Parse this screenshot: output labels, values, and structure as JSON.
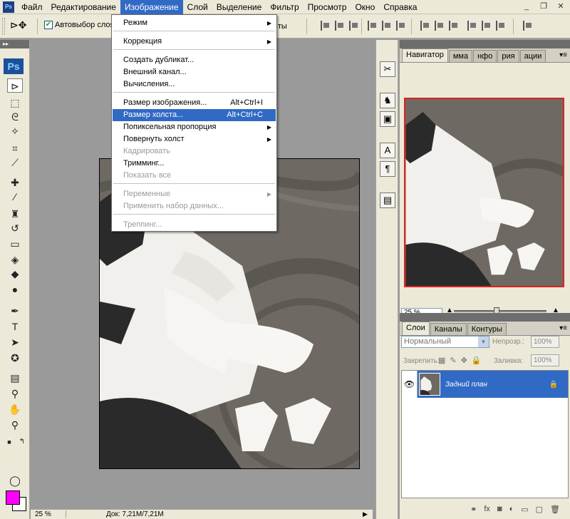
{
  "menubar": {
    "app_icon": "Ps",
    "items": [
      "Файл",
      "Редактирование",
      "Изображение",
      "Слой",
      "Выделение",
      "Фильтр",
      "Просмотр",
      "Окно",
      "Справка"
    ]
  },
  "options": {
    "autoselect_label": "Автовыбор слоя",
    "transform_label": "ементы"
  },
  "toolbox": {
    "logo": "Ps",
    "fg_color": "#ff00ff",
    "bg_color": "#ffffff"
  },
  "image_menu": {
    "items": [
      {
        "label": "Режим",
        "shortcut": "",
        "submenu": true,
        "disabled": false
      },
      {
        "label": "Коррекция",
        "shortcut": "",
        "submenu": true,
        "disabled": false
      },
      {
        "label": "Создать дубликат...",
        "shortcut": "",
        "submenu": false,
        "disabled": false
      },
      {
        "label": "Внешний канал...",
        "shortcut": "",
        "submenu": false,
        "disabled": false
      },
      {
        "label": "Вычисления...",
        "shortcut": "",
        "submenu": false,
        "disabled": false
      },
      {
        "label": "Размер изображения...",
        "shortcut": "Alt+Ctrl+I",
        "submenu": false,
        "disabled": false
      },
      {
        "label": "Размер холста...",
        "shortcut": "Alt+Ctrl+C",
        "submenu": false,
        "disabled": false,
        "highlighted": true
      },
      {
        "label": "Попиксельная пропорция",
        "shortcut": "",
        "submenu": true,
        "disabled": false
      },
      {
        "label": "Повернуть холст",
        "shortcut": "",
        "submenu": true,
        "disabled": false
      },
      {
        "label": "Кадрировать",
        "shortcut": "",
        "submenu": false,
        "disabled": true
      },
      {
        "label": "Тримминг...",
        "shortcut": "",
        "submenu": false,
        "disabled": false
      },
      {
        "label": "Показать все",
        "shortcut": "",
        "submenu": false,
        "disabled": true
      },
      {
        "label": "Переменные",
        "shortcut": "",
        "submenu": true,
        "disabled": true
      },
      {
        "label": "Применить набор данных...",
        "shortcut": "",
        "submenu": false,
        "disabled": true
      },
      {
        "label": "Треппинг...",
        "shortcut": "",
        "submenu": false,
        "disabled": true
      }
    ]
  },
  "navigator_panel": {
    "tabs": [
      "Навигатор",
      "мма",
      "нфо",
      "рия",
      "ации"
    ],
    "zoom": "25 %"
  },
  "layers_panel": {
    "tabs": [
      "Слои",
      "Каналы",
      "Контуры"
    ],
    "blend_mode": "Нормальный",
    "opacity_label": "Непрозр.:",
    "opacity": "100%",
    "lock_label": "Закрепить:",
    "fill_label": "Заливка:",
    "fill": "100%",
    "layer_name": "Задний план"
  },
  "statusbar": {
    "zoom": "25 %",
    "doc": "Док: 7,21M/7,21M"
  }
}
